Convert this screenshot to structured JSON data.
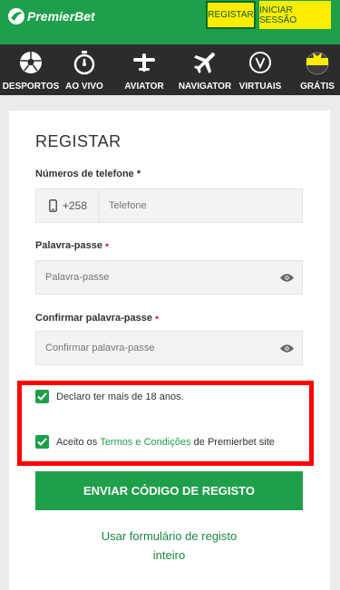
{
  "header": {
    "logo_text": "PremierBet",
    "register_label": "REGISTAR",
    "login_label": "INICIAR SESSÃO",
    "brand_color": "#1ea04a",
    "accent_color": "#ffec00"
  },
  "nav": {
    "items": [
      {
        "label": "DESPORTOS",
        "icon": "soccer-ball-icon"
      },
      {
        "label": "AO VIVO",
        "icon": "stopwatch-icon"
      },
      {
        "label": "AVIATOR",
        "icon": "propeller-plane-icon"
      },
      {
        "label": "NAVIGATOR",
        "icon": "airplane-icon"
      },
      {
        "label": "VIRTUAIS",
        "icon": "virtual-v-icon"
      },
      {
        "label": "GRÁTIS",
        "icon": "free-badge-icon",
        "badge": "GRÁTIS"
      }
    ]
  },
  "form": {
    "title": "REGISTAR",
    "phone_label": "Números de telefone *",
    "phone_prefix": "+258",
    "phone_placeholder": "Telefone",
    "password_label": "Palavra-passe",
    "password_placeholder": "Palavra-passe",
    "confirm_label": "Confirmar palavra-passe",
    "confirm_placeholder": "Confirmar palavra-passe",
    "required_mark": "•",
    "age_check": "Declaro ter mais de 18 anos.",
    "terms_prefix": "Aceito os ",
    "terms_link": "Termos e Condições",
    "terms_suffix": " de Premierbet site",
    "submit_label": "ENVIAR CÓDIGO DE REGISTO",
    "full_form_line1": "Usar formulário de registo",
    "full_form_line2": "inteiro"
  }
}
